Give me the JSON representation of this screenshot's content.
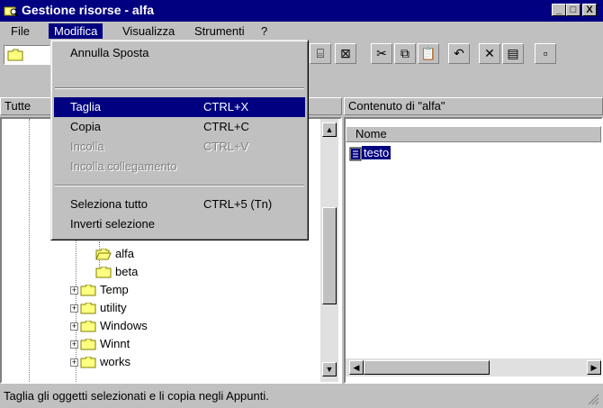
{
  "window": {
    "title": "Gestione risorse - alfa",
    "caption_buttons": {
      "minimize": "_",
      "maximize": "□",
      "close": "X"
    }
  },
  "menubar": {
    "items": [
      {
        "label": "File"
      },
      {
        "label": "Modifica"
      },
      {
        "label": "Visualizza"
      },
      {
        "label": "Strumenti"
      },
      {
        "label": "?"
      }
    ]
  },
  "edit_menu": {
    "items": [
      {
        "label": "Annulla Sposta",
        "shortcut": ""
      },
      {
        "label": "Taglia",
        "shortcut": "CTRL+X"
      },
      {
        "label": "Copia",
        "shortcut": "CTRL+C"
      },
      {
        "label": "Incolla",
        "shortcut": "CTRL+V"
      },
      {
        "label": "Incolla collegamento",
        "shortcut": ""
      },
      {
        "label": "Seleziona tutto",
        "shortcut": "CTRL+5 (Tn)"
      },
      {
        "label": "Inverti selezione",
        "shortcut": ""
      }
    ]
  },
  "panes": {
    "left_header": "Tutte",
    "right_header": "Contenuto di \"alfa\""
  },
  "tree": {
    "items": [
      {
        "label": "alfa"
      },
      {
        "label": "beta"
      },
      {
        "label": "Temp"
      },
      {
        "label": "utility"
      },
      {
        "label": "Windows"
      },
      {
        "label": "Winnt"
      },
      {
        "label": "works"
      }
    ]
  },
  "list": {
    "column_header": "Nome",
    "files": [
      {
        "label": "testo"
      }
    ]
  },
  "statusbar": {
    "text": "Taglia gli oggetti selezionati e li copia negli Appunti."
  },
  "colors": {
    "titlebar": "#000080",
    "selection": "#000080",
    "face": "#c0c0c0",
    "folder": "#ffff80"
  }
}
